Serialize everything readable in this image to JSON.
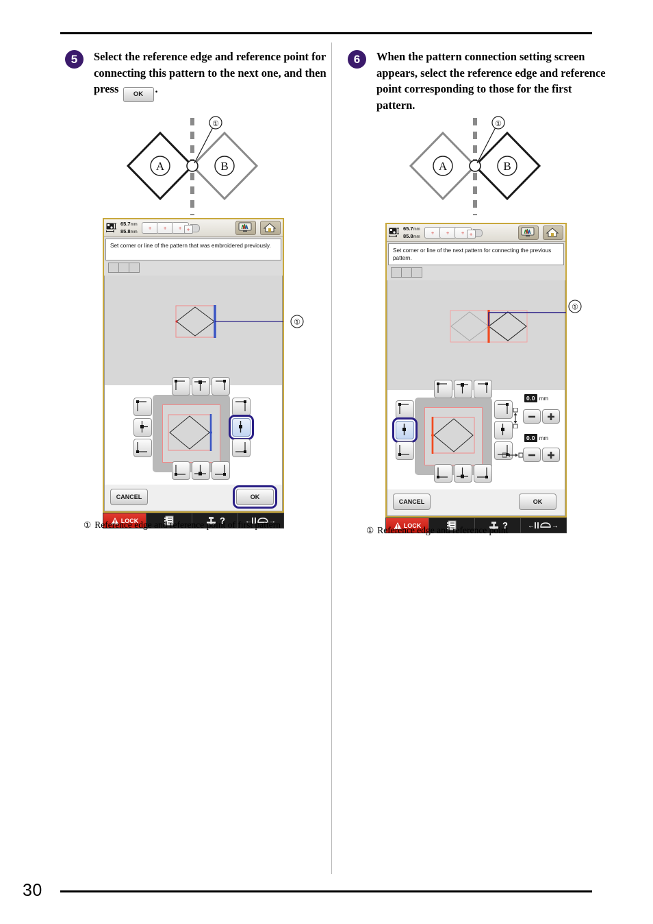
{
  "page": {
    "number": "30"
  },
  "steps": [
    {
      "num": "5",
      "text_before": "Select the reference edge and reference point for connecting this pattern to the next one, and then press",
      "inline_button": "OK",
      "text_after": ".",
      "diagram": {
        "label_a": "A",
        "label_b": "B",
        "callout": "①",
        "active_side": "left"
      },
      "screen": {
        "dims": {
          "width": "65.7",
          "height": "85.8",
          "unit": "mm"
        },
        "message": "Set corner or line of the pattern that was embroidered previously.",
        "buttons": {
          "cancel": "CANCEL",
          "ok": "OK"
        },
        "taskbar": {
          "lock": "LOCK"
        },
        "callout": "①",
        "highlight": {
          "cell": "right-middle",
          "ok_highlighted": true
        },
        "has_offset_controls": false
      },
      "caption": {
        "num": "①",
        "text": "Reference edge and reference point of first pattern"
      }
    },
    {
      "num": "6",
      "text_before": "When the pattern connection setting screen appears, select the reference edge and reference point corresponding to those for the first pattern.",
      "inline_button": "",
      "text_after": "",
      "diagram": {
        "label_a": "A",
        "label_b": "B",
        "callout": "①",
        "active_side": "right"
      },
      "screen": {
        "dims": {
          "width": "65.7",
          "height": "85.8",
          "unit": "mm"
        },
        "message": "Set corner or line of the next pattern for connecting the previous pattern.",
        "buttons": {
          "cancel": "CANCEL",
          "ok": "OK"
        },
        "taskbar": {
          "lock": "LOCK"
        },
        "callout": "①",
        "highlight": {
          "cell": "left-middle",
          "ok_highlighted": false
        },
        "has_offset_controls": true,
        "offset_controls": [
          {
            "value": "0.0",
            "unit": "mm",
            "axis": "vertical",
            "minus": "−",
            "plus": "+"
          },
          {
            "value": "0.0",
            "unit": "mm",
            "axis": "horizontal",
            "minus": "−",
            "plus": "+"
          }
        ]
      },
      "caption": {
        "num": "①",
        "text": "Reference edge and reference point"
      }
    }
  ],
  "colors": {
    "bullet_purple": "#3b1a6b",
    "highlight_blue": "#2a1f86",
    "lock_red": "#c0150c",
    "frame_gold": "#c8a83c",
    "preview_pink": "#f08a8a",
    "edge_blue": "#3a55c4",
    "edge_red": "#f04b20"
  }
}
